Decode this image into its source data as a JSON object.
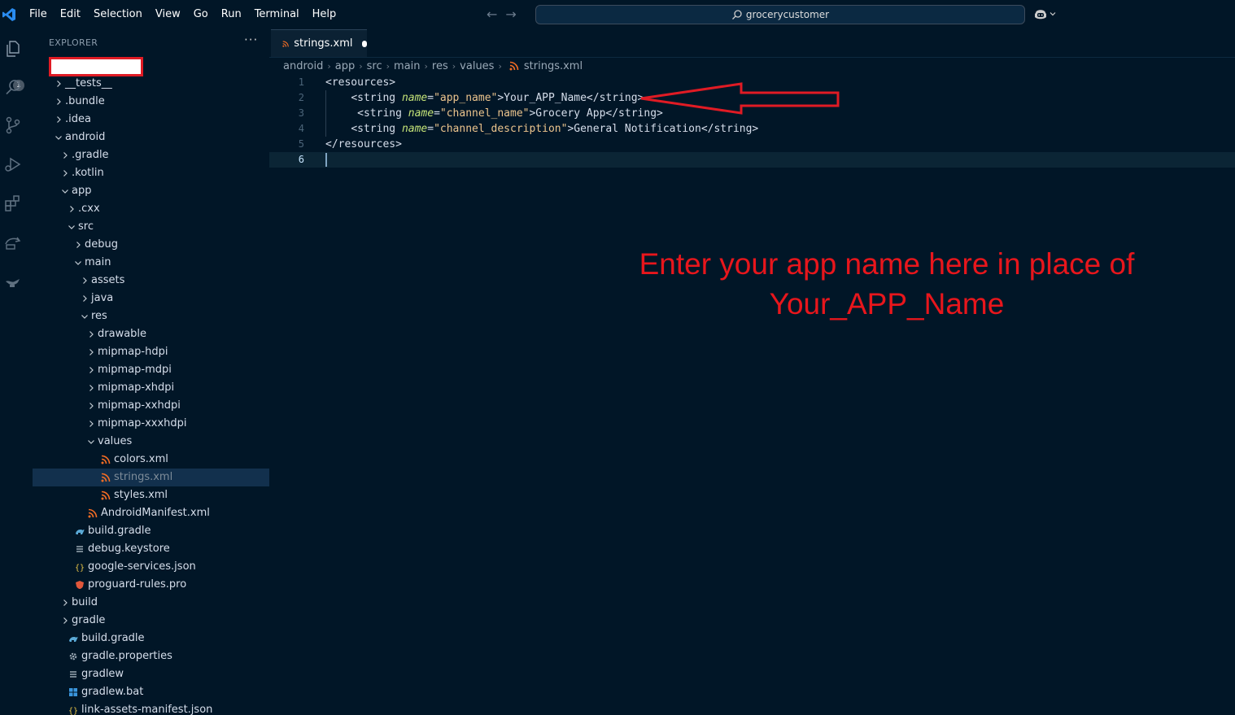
{
  "menu": [
    "File",
    "Edit",
    "Selection",
    "View",
    "Go",
    "Run",
    "Terminal",
    "Help"
  ],
  "command_center": {
    "text": "grocerycustomer"
  },
  "activity": {
    "explorer_badge": "1"
  },
  "explorer": {
    "title": "EXPLORER",
    "more": "···",
    "items": [
      {
        "label": "",
        "indent": 0,
        "chevron": "down",
        "icon": "none",
        "redacted": true
      },
      {
        "label": "__tests__",
        "indent": 1,
        "chevron": "right",
        "icon": "none"
      },
      {
        "label": ".bundle",
        "indent": 1,
        "chevron": "right",
        "icon": "none"
      },
      {
        "label": ".idea",
        "indent": 1,
        "chevron": "right",
        "icon": "none"
      },
      {
        "label": "android",
        "indent": 1,
        "chevron": "down",
        "icon": "none"
      },
      {
        "label": ".gradle",
        "indent": 2,
        "chevron": "right",
        "icon": "none"
      },
      {
        "label": ".kotlin",
        "indent": 2,
        "chevron": "right",
        "icon": "none"
      },
      {
        "label": "app",
        "indent": 2,
        "chevron": "down",
        "icon": "none"
      },
      {
        "label": ".cxx",
        "indent": 3,
        "chevron": "right",
        "icon": "none"
      },
      {
        "label": "src",
        "indent": 3,
        "chevron": "down",
        "icon": "none"
      },
      {
        "label": "debug",
        "indent": 4,
        "chevron": "right",
        "icon": "none"
      },
      {
        "label": "main",
        "indent": 4,
        "chevron": "down",
        "icon": "none"
      },
      {
        "label": "assets",
        "indent": 5,
        "chevron": "right",
        "icon": "none"
      },
      {
        "label": "java",
        "indent": 5,
        "chevron": "right",
        "icon": "none"
      },
      {
        "label": "res",
        "indent": 5,
        "chevron": "down",
        "icon": "none"
      },
      {
        "label": "drawable",
        "indent": 6,
        "chevron": "right",
        "icon": "none"
      },
      {
        "label": "mipmap-hdpi",
        "indent": 6,
        "chevron": "right",
        "icon": "none"
      },
      {
        "label": "mipmap-mdpi",
        "indent": 6,
        "chevron": "right",
        "icon": "none"
      },
      {
        "label": "mipmap-xhdpi",
        "indent": 6,
        "chevron": "right",
        "icon": "none"
      },
      {
        "label": "mipmap-xxhdpi",
        "indent": 6,
        "chevron": "right",
        "icon": "none"
      },
      {
        "label": "mipmap-xxxhdpi",
        "indent": 6,
        "chevron": "right",
        "icon": "none"
      },
      {
        "label": "values",
        "indent": 6,
        "chevron": "down",
        "icon": "none"
      },
      {
        "label": "colors.xml",
        "indent": 7,
        "chevron": "none",
        "icon": "rss"
      },
      {
        "label": "strings.xml",
        "indent": 7,
        "chevron": "none",
        "icon": "rss",
        "selected": true
      },
      {
        "label": "styles.xml",
        "indent": 7,
        "chevron": "none",
        "icon": "rss"
      },
      {
        "label": "AndroidManifest.xml",
        "indent": 5,
        "chevron": "none",
        "icon": "rss"
      },
      {
        "label": "build.gradle",
        "indent": 3,
        "chevron": "none",
        "icon": "gradle"
      },
      {
        "label": "debug.keystore",
        "indent": 3,
        "chevron": "none",
        "icon": "lines"
      },
      {
        "label": "google-services.json",
        "indent": 3,
        "chevron": "none",
        "icon": "json"
      },
      {
        "label": "proguard-rules.pro",
        "indent": 3,
        "chevron": "none",
        "icon": "shield"
      },
      {
        "label": "build",
        "indent": 2,
        "chevron": "right",
        "icon": "none"
      },
      {
        "label": "gradle",
        "indent": 2,
        "chevron": "right",
        "icon": "none"
      },
      {
        "label": "build.gradle",
        "indent": 2,
        "chevron": "none",
        "icon": "gradle"
      },
      {
        "label": "gradle.properties",
        "indent": 2,
        "chevron": "none",
        "icon": "gear"
      },
      {
        "label": "gradlew",
        "indent": 2,
        "chevron": "none",
        "icon": "lines"
      },
      {
        "label": "gradlew.bat",
        "indent": 2,
        "chevron": "none",
        "icon": "windows"
      },
      {
        "label": "link-assets-manifest.json",
        "indent": 2,
        "chevron": "none",
        "icon": "json"
      }
    ]
  },
  "editor": {
    "tab": {
      "label": "strings.xml",
      "dirty": true
    },
    "breadcrumb": [
      "android",
      "app",
      "src",
      "main",
      "res",
      "values",
      "strings.xml"
    ],
    "lines": [
      {
        "num": "1",
        "indent": 0,
        "parts": [
          [
            "tag",
            "<resources>"
          ]
        ]
      },
      {
        "num": "2",
        "indent": 1,
        "parts": [
          [
            "tag",
            "<string "
          ],
          [
            "attr",
            "name"
          ],
          [
            "tag",
            "="
          ],
          [
            "aval",
            "\"app_name\""
          ],
          [
            "tag",
            ">Your_APP_Name</string>"
          ]
        ]
      },
      {
        "num": "3",
        "indent": 1,
        "extra": 1,
        "parts": [
          [
            "tag",
            "<string "
          ],
          [
            "attr",
            "name"
          ],
          [
            "tag",
            "="
          ],
          [
            "aval",
            "\"channel_name\""
          ],
          [
            "tag",
            ">Grocery App</string>"
          ]
        ]
      },
      {
        "num": "4",
        "indent": 1,
        "parts": [
          [
            "tag",
            "<string "
          ],
          [
            "attr",
            "name"
          ],
          [
            "tag",
            "="
          ],
          [
            "aval",
            "\"channel_description\""
          ],
          [
            "tag",
            ">General Notification</string>"
          ]
        ]
      },
      {
        "num": "5",
        "indent": 0,
        "parts": [
          [
            "tag",
            "</resources>"
          ]
        ]
      },
      {
        "num": "6",
        "indent": 0,
        "parts": [],
        "current": true
      }
    ]
  },
  "annotation": {
    "line1": "Enter your app name here in place of",
    "line2": "Your_APP_Name",
    "color": "#e8161c"
  },
  "colors": {
    "background": "#011627",
    "accent_blue": "#2a8cf0",
    "xml_icon": "#f56d24",
    "selection": "#12304d"
  }
}
